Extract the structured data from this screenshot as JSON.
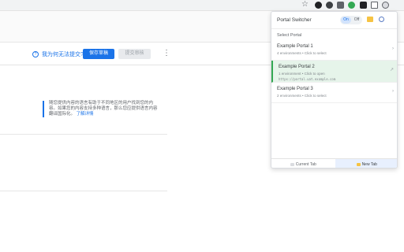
{
  "browser": {
    "toolbar_icons": [
      "star-icon",
      "extension-icon-1",
      "extension-icon-2",
      "extension-icon-3",
      "extension-icon-4",
      "extension-icon-5",
      "puzzle-icon",
      "profile-icon"
    ],
    "star_glyph": "☆"
  },
  "toolbar": {
    "help_text": "我为何无法提交?",
    "help_glyph": "?",
    "save_label": "保存草稿",
    "submit_label": "提交审核",
    "more_glyph": "⋮"
  },
  "notice": {
    "text": "随您提供内容的语言有助于不同地区的用户找到您的内容。如果您的内容支持多种语言，那么您应提供语言内容翻译国际化。",
    "link": "了解详情"
  },
  "page": {
    "right_chevron": "⌄"
  },
  "popup": {
    "title": "Portal Switcher",
    "toggle_on": "On",
    "toggle_off": "Off",
    "select_label": "Select Portal",
    "portals": [
      {
        "name": "Example Portal 1",
        "meta": "4 environments • Click to select",
        "url": "",
        "chevron": "›",
        "active": false
      },
      {
        "name": "Example Portal 2",
        "meta": "1 environment • Click to open",
        "url": "https://portal.uat.example.com",
        "chevron": "↗",
        "active": true
      },
      {
        "name": "Example Portal 3",
        "meta": "2 environments • Click to select",
        "url": "",
        "chevron": "›",
        "active": false
      }
    ],
    "footer": {
      "current_tab": "Current Tab",
      "new_tab": "New Tab"
    }
  },
  "colors": {
    "accent": "#1a73e8",
    "active_portal": "#34a853",
    "active_portal_bg": "#e6f4ea"
  }
}
